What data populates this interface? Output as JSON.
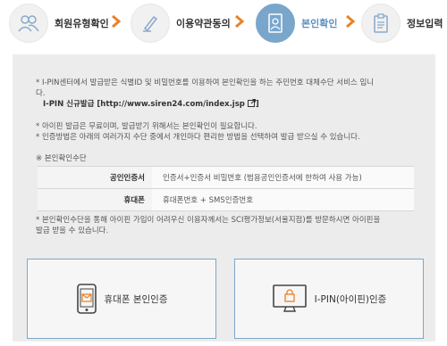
{
  "steps": [
    {
      "label": "회원유형확인",
      "icon": "people-icon"
    },
    {
      "label": "이용약관동의",
      "icon": "pen-icon"
    },
    {
      "label": "본인확인",
      "icon": "id-card-icon"
    },
    {
      "label": "정보입력",
      "icon": "clipboard-icon"
    }
  ],
  "active_step": 2,
  "colors": {
    "accent": "#7aa6cc",
    "arrow": "#e8822a",
    "panel": "#ececec",
    "button_border": "#7fa7c9"
  },
  "notes": {
    "ipin_line1": "* I-PIN센터에서 발급받은 식별ID 및 비밀번호를 이용하여 본인확인을 하는 주민번호 대체수단 서비스 입니",
    "ipin_line2": "다.",
    "ipin_issue_label": "I-PIN 신규발급 [http://www.siren24.com/index.jsp",
    "ipin_issue_close": "]",
    "free_note": "* 아이핀 발급은 무료이며, 발급받기 위해서는 본인확인이 필요합니다.",
    "method_note": "* 인증방법은 아래의 여러가지 수단 중에서 개인마다 편리한 방법을 선택하여 발급 받으실 수 있습니다.",
    "means_heading": "※ 본인확인수단",
    "bottom_line1": "* 본인확인수단을 통해 아이핀 가입이 어려우신 이용자께서는 SCI평가정보(서울지점)를 방문하시면 아이핀을",
    "bottom_line2": "발급 받을 수 있습니다."
  },
  "means_table": [
    {
      "label": "공인인증서",
      "value": "인증서+인증서 비밀번호 (범용공인인증서에 한하여 사용 가능)"
    },
    {
      "label": "휴대폰",
      "value": "휴대폰번호 + SMS인증번호"
    }
  ],
  "buttons": {
    "phone": {
      "label": "휴대폰 본인인증",
      "icon": "mobile-mail-icon"
    },
    "ipin": {
      "label": "I-PIN(아이핀)인증",
      "icon": "monitor-lock-icon"
    }
  }
}
